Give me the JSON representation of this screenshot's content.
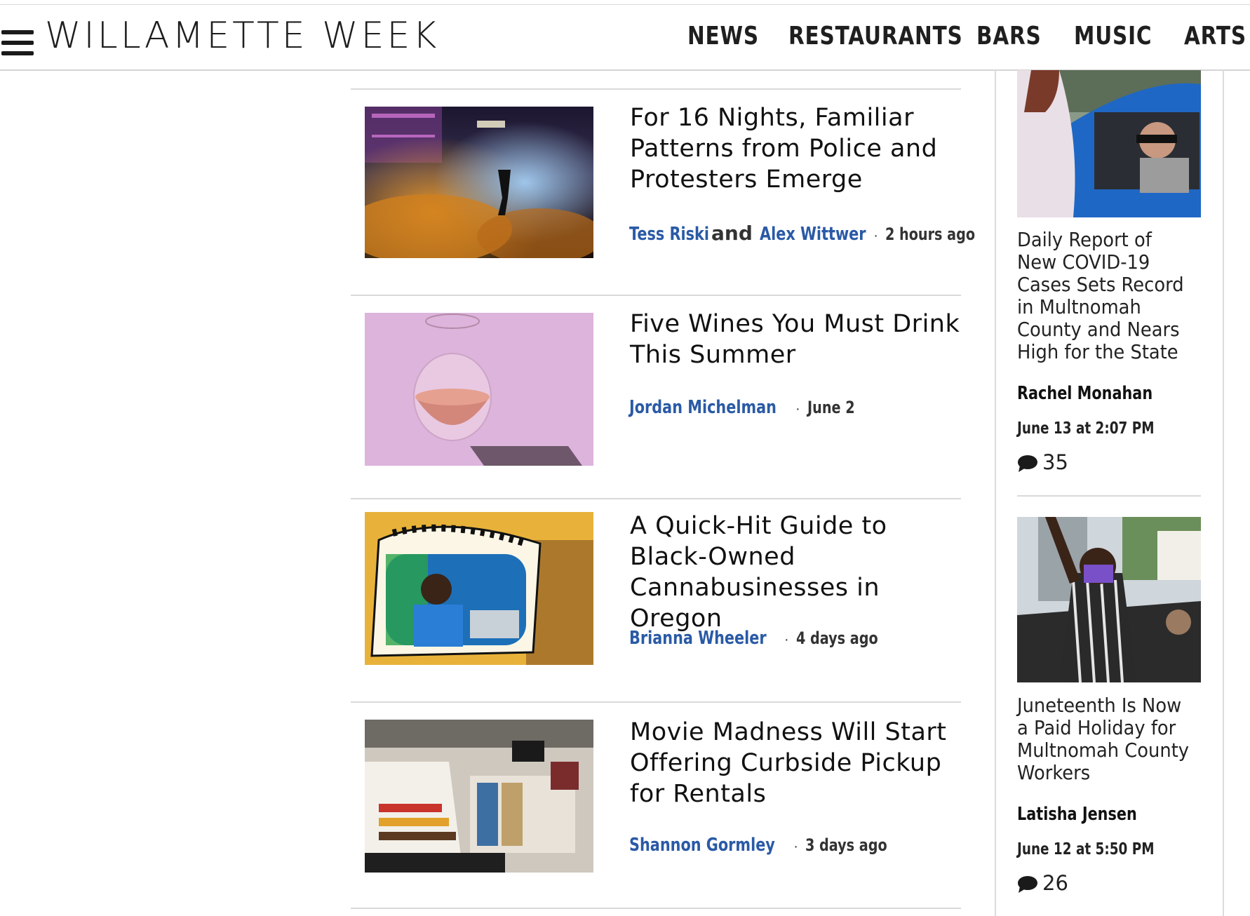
{
  "site": {
    "logo_text": "WILLAMETTE WEEK",
    "menu_icon": "hamburger-menu-icon"
  },
  "nav": {
    "items": [
      {
        "label": "NEWS"
      },
      {
        "label": "RESTAURANTS"
      },
      {
        "label": "BARS"
      },
      {
        "label": "MUSIC"
      },
      {
        "label": "ARTS"
      }
    ]
  },
  "articles": [
    {
      "headline": "For 16 Nights, Familiar Patterns from Police and Protesters Emerge",
      "authors": [
        "Tess Riski",
        "Alex Wittwer"
      ],
      "joiner": "and",
      "date": "2 hours ago"
    },
    {
      "headline": "Five Wines You Must Drink This Summer",
      "authors": [
        "Jordan Michelman"
      ],
      "date": "June 2"
    },
    {
      "headline": "A Quick-Hit Guide to Black-Owned Cannabusinesses in Oregon",
      "authors": [
        "Brianna Wheeler"
      ],
      "date": "4 days ago"
    },
    {
      "headline": "Movie Madness Will Start Offering Curbside Pickup for Rentals",
      "authors": [
        "Shannon Gormley"
      ],
      "date": "3 days ago"
    }
  ],
  "sidebar": {
    "stories": [
      {
        "title": "Daily Report of New COVID-19 Cases Sets Record in Multnomah County and Nears High for the State",
        "author": "Rachel Monahan",
        "date": "June 13 at 2:07 PM",
        "comments": "35"
      },
      {
        "title": "Juneteenth Is Now a Paid Holiday for Multnomah County Workers",
        "author": "Latisha Jensen",
        "date": "June 12 at 5:50 PM",
        "comments": "26"
      }
    ]
  },
  "colors": {
    "author_link": "#2a5aa6",
    "divider": "#d9d9d9"
  }
}
